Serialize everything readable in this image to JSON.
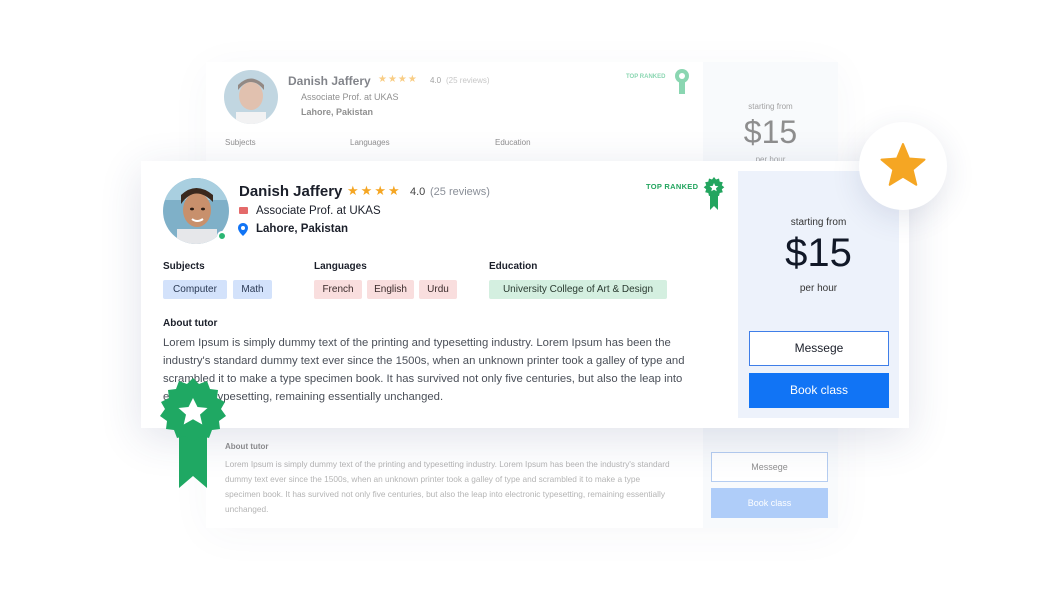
{
  "background_card": {
    "name": "Danish Jaffery",
    "stars": "★★★★",
    "rating": "4.0",
    "reviews": "(25 reviews)",
    "title": "Associate Prof. at UKAS",
    "location": "Lahore, Pakistan",
    "top_ranked": "TOP RANKED",
    "subjects_label": "Subjects",
    "languages_label": "Languages",
    "education_label": "Education",
    "about_label": "About tutor",
    "about_text": "Lorem Ipsum is simply dummy text of the printing and typesetting industry. Lorem Ipsum has been the industry's standard dummy text ever since the 1500s, when an unknown printer took a galley of type and scrambled it to make a type specimen book. It has survived not only five centuries, but also the leap into electronic typesetting, remaining essentially unchanged.",
    "starting_from": "starting from",
    "price": "$15",
    "per_hour": "per hour",
    "message_button": "Messege",
    "book_button": "Book class"
  },
  "tutor": {
    "name": "Danish Jaffery",
    "stars_filled": 4,
    "rating": "4.0",
    "reviews": "(25 reviews)",
    "title": "Associate Prof. at UKAS",
    "location": "Lahore, Pakistan",
    "online": true,
    "top_ranked_label": "TOP RANKED"
  },
  "sections": {
    "subjects_label": "Subjects",
    "subjects": [
      "Computer",
      "Math"
    ],
    "languages_label": "Languages",
    "languages": [
      "French",
      "English",
      "Urdu"
    ],
    "education_label": "Education",
    "education": [
      "University College of Art & Design"
    ]
  },
  "about": {
    "label": "About tutor",
    "text": "Lorem Ipsum is simply dummy text of the printing and typesetting industry. Lorem Ipsum has been the industry's standard dummy text ever since the 1500s, when an unknown printer took a galley of type and scrambled it to make a type specimen book. It has survived not only five centuries, but also the leap into electronic typesetting, remaining essentially unchanged."
  },
  "pricing": {
    "starting_from": "starting from",
    "price": "$15",
    "per_hour": "per hour",
    "message_button": "Messege",
    "book_button": "Book class"
  },
  "icons": {
    "star": "star-icon",
    "briefcase": "briefcase-icon",
    "location": "location-pin-icon",
    "ribbon": "award-ribbon-icon"
  },
  "colors": {
    "accent_blue": "#1174f5",
    "star_gold": "#f5a623",
    "ribbon_green": "#23a55f",
    "online_green": "#2bb673",
    "subject_tag": "#d3e2fb",
    "language_tag": "#f9dede",
    "education_tag": "#d4efe0"
  }
}
